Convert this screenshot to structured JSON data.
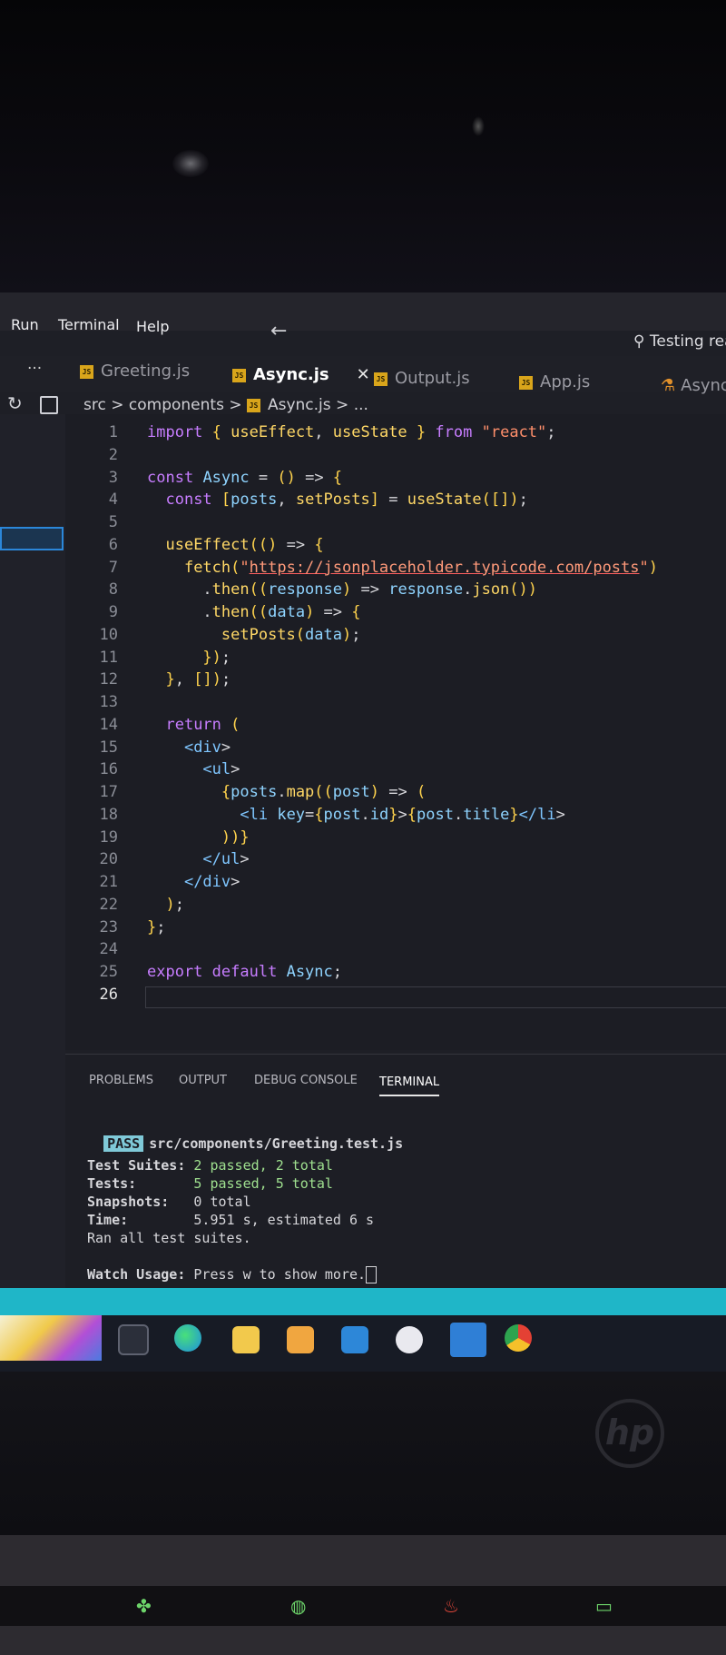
{
  "menubar": {
    "items": [
      "Run",
      "Terminal",
      "Help"
    ],
    "search_placeholder": "Testing rea"
  },
  "tabs": [
    {
      "label": "Greeting.js",
      "type": "js",
      "active": false
    },
    {
      "label": "Async.js",
      "type": "js",
      "active": true
    },
    {
      "label": "Output.js",
      "type": "js",
      "active": false
    },
    {
      "label": "App.js",
      "type": "js",
      "active": false
    },
    {
      "label": "Async",
      "type": "test",
      "active": false
    }
  ],
  "tab_icon_text": "JS",
  "overflow_label": "···",
  "close_label": "✕",
  "breadcrumb": {
    "part1": "src",
    "part2": "components",
    "file": "Async.js",
    "more": "..."
  },
  "code_lines": [
    "import { useEffect, useState } from \"react\";",
    "",
    "const Async = () => {",
    "  const [posts, setPosts] = useState([]);",
    "",
    "  useEffect(() => {",
    "    fetch(\"https://jsonplaceholder.typicode.com/posts\")",
    "      .then((response) => response.json())",
    "      .then((data) => {",
    "        setPosts(data);",
    "      });",
    "  }, []);",
    "",
    "  return (",
    "    <div>",
    "      <ul>",
    "        {posts.map((post) => (",
    "          <li key={post.id}>{post.title}</li>",
    "        ))}",
    "      </ul>",
    "    </div>",
    "  );",
    "};",
    "",
    "export default Async;",
    ""
  ],
  "panel_tabs": [
    "PROBLEMS",
    "OUTPUT",
    "DEBUG CONSOLE",
    "TERMINAL"
  ],
  "terminal": {
    "pass_badge": "PASS",
    "test_file": "src/components/Greeting.test.js",
    "suites_label": "Test Suites:",
    "suites_value": "2 passed, 2 total",
    "tests_label": "Tests:",
    "tests_value": "5 passed, 5 total",
    "snapshots_label": "Snapshots:",
    "snapshots_value": "0 total",
    "time_label": "Time:",
    "time_value": "5.951 s, estimated 6 s",
    "ran_line": "Ran all test suites.",
    "watch_label": "Watch Usage:",
    "watch_value": "Press w to show more."
  },
  "brand_logo": "hp"
}
